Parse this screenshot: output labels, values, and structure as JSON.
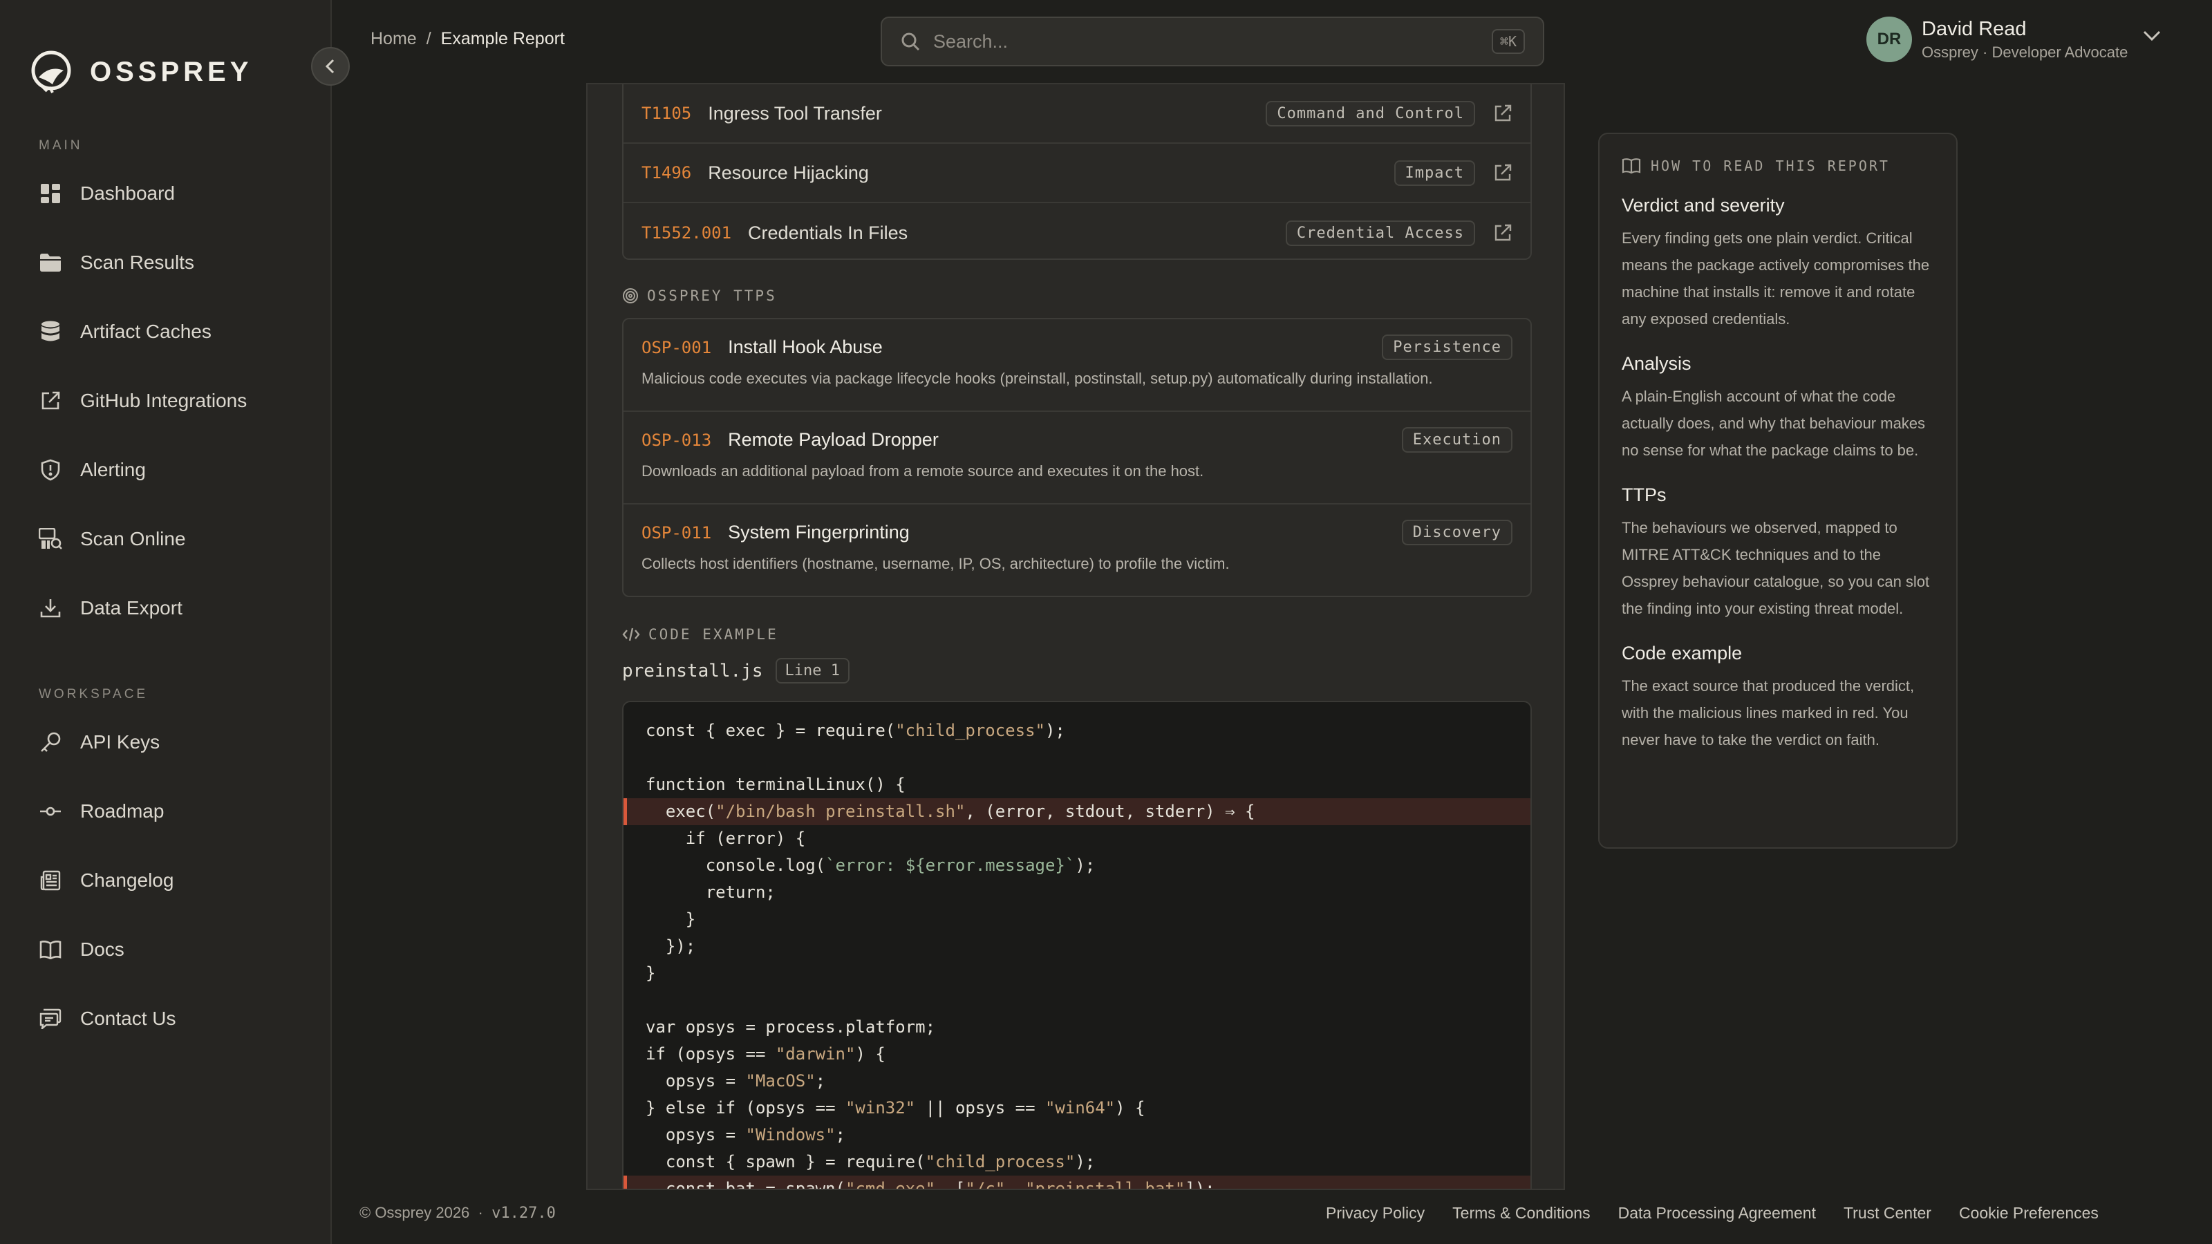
{
  "app": {
    "name": "OSSPREY"
  },
  "sidebar": {
    "main_label": "MAIN",
    "main_items": [
      {
        "label": "Dashboard",
        "icon": "dashboard-icon"
      },
      {
        "label": "Scan Results",
        "icon": "folder-icon"
      },
      {
        "label": "Artifact Caches",
        "icon": "database-icon"
      },
      {
        "label": "GitHub Integrations",
        "icon": "external-link-icon"
      },
      {
        "label": "Alerting",
        "icon": "shield-icon"
      },
      {
        "label": "Scan Online",
        "icon": "scan-icon"
      },
      {
        "label": "Data Export",
        "icon": "download-icon"
      }
    ],
    "workspace_label": "WORKSPACE",
    "workspace_items": [
      {
        "label": "API Keys",
        "icon": "key-icon"
      },
      {
        "label": "Roadmap",
        "icon": "commit-icon"
      },
      {
        "label": "Changelog",
        "icon": "newspaper-icon"
      },
      {
        "label": "Docs",
        "icon": "book-icon"
      },
      {
        "label": "Contact Us",
        "icon": "chat-icon"
      }
    ]
  },
  "header": {
    "breadcrumb": {
      "home": "Home",
      "sep": "/",
      "current": "Example Report"
    },
    "search": {
      "placeholder": "Search...",
      "shortcut": "⌘K"
    },
    "user": {
      "initials": "DR",
      "name": "David Read",
      "role": "Ossprey · Developer Advocate"
    }
  },
  "mitre": [
    {
      "id": "T1105",
      "name": "Ingress Tool Transfer",
      "tactic": "Command and Control"
    },
    {
      "id": "T1496",
      "name": "Resource Hijacking",
      "tactic": "Impact"
    },
    {
      "id": "T1552.001",
      "name": "Credentials In Files",
      "tactic": "Credential Access"
    }
  ],
  "ttps": {
    "heading": "OSSPREY TTPS",
    "items": [
      {
        "id": "OSP-001",
        "name": "Install Hook Abuse",
        "tactic": "Persistence",
        "desc": "Malicious code executes via package lifecycle hooks (preinstall, postinstall, setup.py) automatically during installation."
      },
      {
        "id": "OSP-013",
        "name": "Remote Payload Dropper",
        "tactic": "Execution",
        "desc": "Downloads an additional payload from a remote source and executes it on the host."
      },
      {
        "id": "OSP-011",
        "name": "System Fingerprinting",
        "tactic": "Discovery",
        "desc": "Collects host identifiers (hostname, username, IP, OS, architecture) to profile the victim."
      }
    ]
  },
  "code_example": {
    "heading": "CODE EXAMPLE",
    "filename": "preinstall.js",
    "line": "Line 1",
    "highlight_color": "#d9583b"
  },
  "info_card": {
    "heading": "HOW TO READ THIS REPORT",
    "sections": [
      {
        "title": "Verdict and severity",
        "body": "Every finding gets one plain verdict. Critical means the package actively compromises the machine that installs it: remove it and rotate any exposed credentials."
      },
      {
        "title": "Analysis",
        "body": "A plain-English account of what the code actually does, and why that behaviour makes no sense for what the package claims to be."
      },
      {
        "title": "TTPs",
        "body": "The behaviours we observed, mapped to MITRE ATT&CK techniques and to the Ossprey behaviour catalogue, so you can slot the finding into your existing threat model."
      },
      {
        "title": "Code example",
        "body": "The exact source that produced the verdict, with the malicious lines marked in red. You never have to take the verdict on faith."
      }
    ]
  },
  "footer": {
    "copyright": "© Ossprey 2026",
    "dot": "·",
    "version": "v1.27.0",
    "links": [
      "Privacy Policy",
      "Terms & Conditions",
      "Data Processing Agreement",
      "Trust Center",
      "Cookie Preferences"
    ]
  },
  "colors": {
    "accent": "#e4863a",
    "avatar": "#7fa08a",
    "danger": "#d9583b"
  }
}
